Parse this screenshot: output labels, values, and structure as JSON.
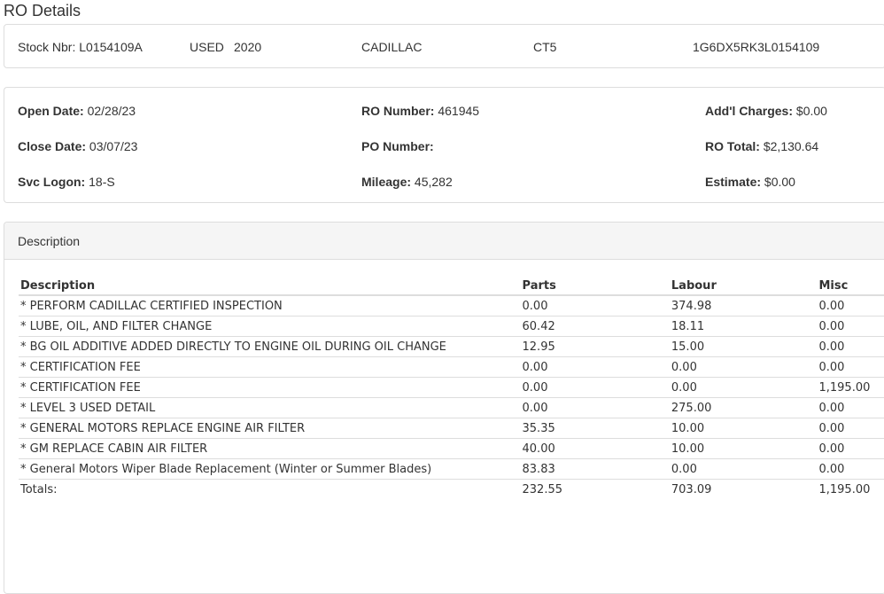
{
  "page_title": "RO Details",
  "vehicle": {
    "stock_nbr": "Stock Nbr: L0154109A",
    "condition": "USED",
    "year": "2020",
    "make": "CADILLAC",
    "model": "CT5",
    "vin": "1G6DX5RK3L0154109"
  },
  "info": {
    "open_date_label": "Open Date:",
    "open_date": "02/28/23",
    "close_date_label": "Close Date:",
    "close_date": "03/07/23",
    "svc_logon_label": "Svc Logon:",
    "svc_logon": "18-S",
    "ro_number_label": "RO Number:",
    "ro_number": "461945",
    "po_number_label": "PO Number:",
    "po_number": "",
    "mileage_label": "Mileage:",
    "mileage": "45,282",
    "addl_charges_label": "Add'l Charges:",
    "addl_charges": "$0.00",
    "ro_total_label": "RO Total:",
    "ro_total": "$2,130.64",
    "estimate_label": "Estimate:",
    "estimate": "$0.00"
  },
  "description_panel": {
    "heading": "Description",
    "columns": [
      "Description",
      "Parts",
      "Labour",
      "Misc"
    ],
    "rows": [
      [
        "* PERFORM CADILLAC CERTIFIED INSPECTION",
        "0.00",
        "374.98",
        "0.00"
      ],
      [
        "* LUBE, OIL, AND FILTER CHANGE",
        "60.42",
        "18.11",
        "0.00"
      ],
      [
        "* BG OIL ADDITIVE ADDED DIRECTLY TO ENGINE OIL DURING OIL CHANGE",
        "12.95",
        "15.00",
        "0.00"
      ],
      [
        "* CERTIFICATION FEE",
        "0.00",
        "0.00",
        "0.00"
      ],
      [
        "* CERTIFICATION FEE",
        "0.00",
        "0.00",
        "1,195.00"
      ],
      [
        "* LEVEL 3 USED DETAIL",
        "0.00",
        "275.00",
        "0.00"
      ],
      [
        "* GENERAL MOTORS REPLACE ENGINE AIR FILTER",
        "35.35",
        "10.00",
        "0.00"
      ],
      [
        "* GM REPLACE CABIN AIR FILTER",
        "40.00",
        "10.00",
        "0.00"
      ],
      [
        "* General Motors Wiper Blade Replacement (Winter or Summer Blades)",
        "83.83",
        "0.00",
        "0.00"
      ]
    ],
    "totals": [
      "Totals:",
      "232.55",
      "703.09",
      "1,195.00"
    ]
  }
}
